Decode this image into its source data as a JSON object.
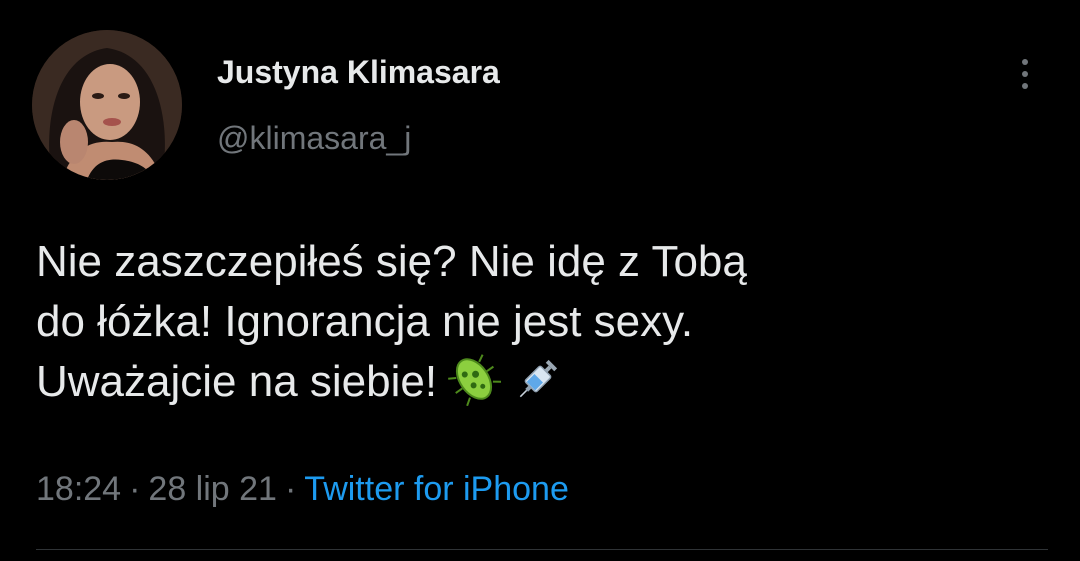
{
  "author": {
    "display_name": "Justyna Klimasara",
    "handle": "@klimasara_j",
    "avatar_icon": "profile-photo"
  },
  "tweet": {
    "lines": [
      "Nie zaszczepiłeś się? Nie idę z Tobą",
      "do łóżka! Ignorancja nie jest sexy.",
      "Uważajcie na siebie!"
    ],
    "emojis": [
      "microbe-emoji",
      "syringe-emoji"
    ]
  },
  "meta": {
    "time": "18:24",
    "separator": "·",
    "date": "28 lip 21",
    "source": "Twitter for iPhone"
  },
  "menu_icon": "more-vertical-icon",
  "colors": {
    "background": "#000000",
    "text": "#e7e9ea",
    "secondary": "#71767b",
    "link": "#1d9bf0",
    "divider": "#2f3336"
  }
}
